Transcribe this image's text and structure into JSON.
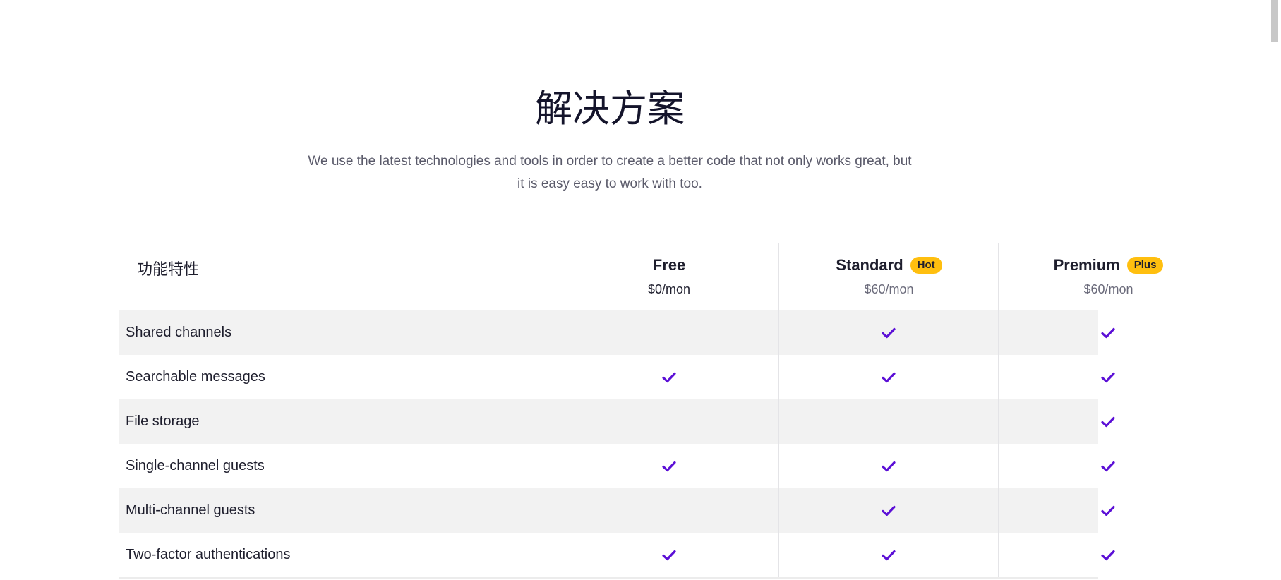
{
  "title": "解决方案",
  "description_line1": "We use the latest technologies and tools in order to create a better code that not only works great, but",
  "description_line2": "it is easy easy to work with too.",
  "accent_color": "#5b0fd6",
  "badge_color": "#ffbf0f",
  "table": {
    "feature_header": "功能特性",
    "plans": [
      {
        "name": "Free",
        "badge": "",
        "price": "$0/mon"
      },
      {
        "name": "Standard",
        "badge": "Hot",
        "price": "$60/mon"
      },
      {
        "name": "Premium",
        "badge": "Plus",
        "price": "$60/mon"
      }
    ],
    "rows": [
      {
        "label": "Shared channels",
        "free": false,
        "standard": true,
        "premium": true
      },
      {
        "label": "Searchable messages",
        "free": true,
        "standard": true,
        "premium": true
      },
      {
        "label": "File storage",
        "free": false,
        "standard": false,
        "premium": true
      },
      {
        "label": "Single-channel guests",
        "free": true,
        "standard": true,
        "premium": true
      },
      {
        "label": "Multi-channel guests",
        "free": false,
        "standard": true,
        "premium": true
      },
      {
        "label": "Two-factor authentications",
        "free": true,
        "standard": true,
        "premium": true
      }
    ]
  },
  "icons": {
    "check": "check-icon"
  }
}
